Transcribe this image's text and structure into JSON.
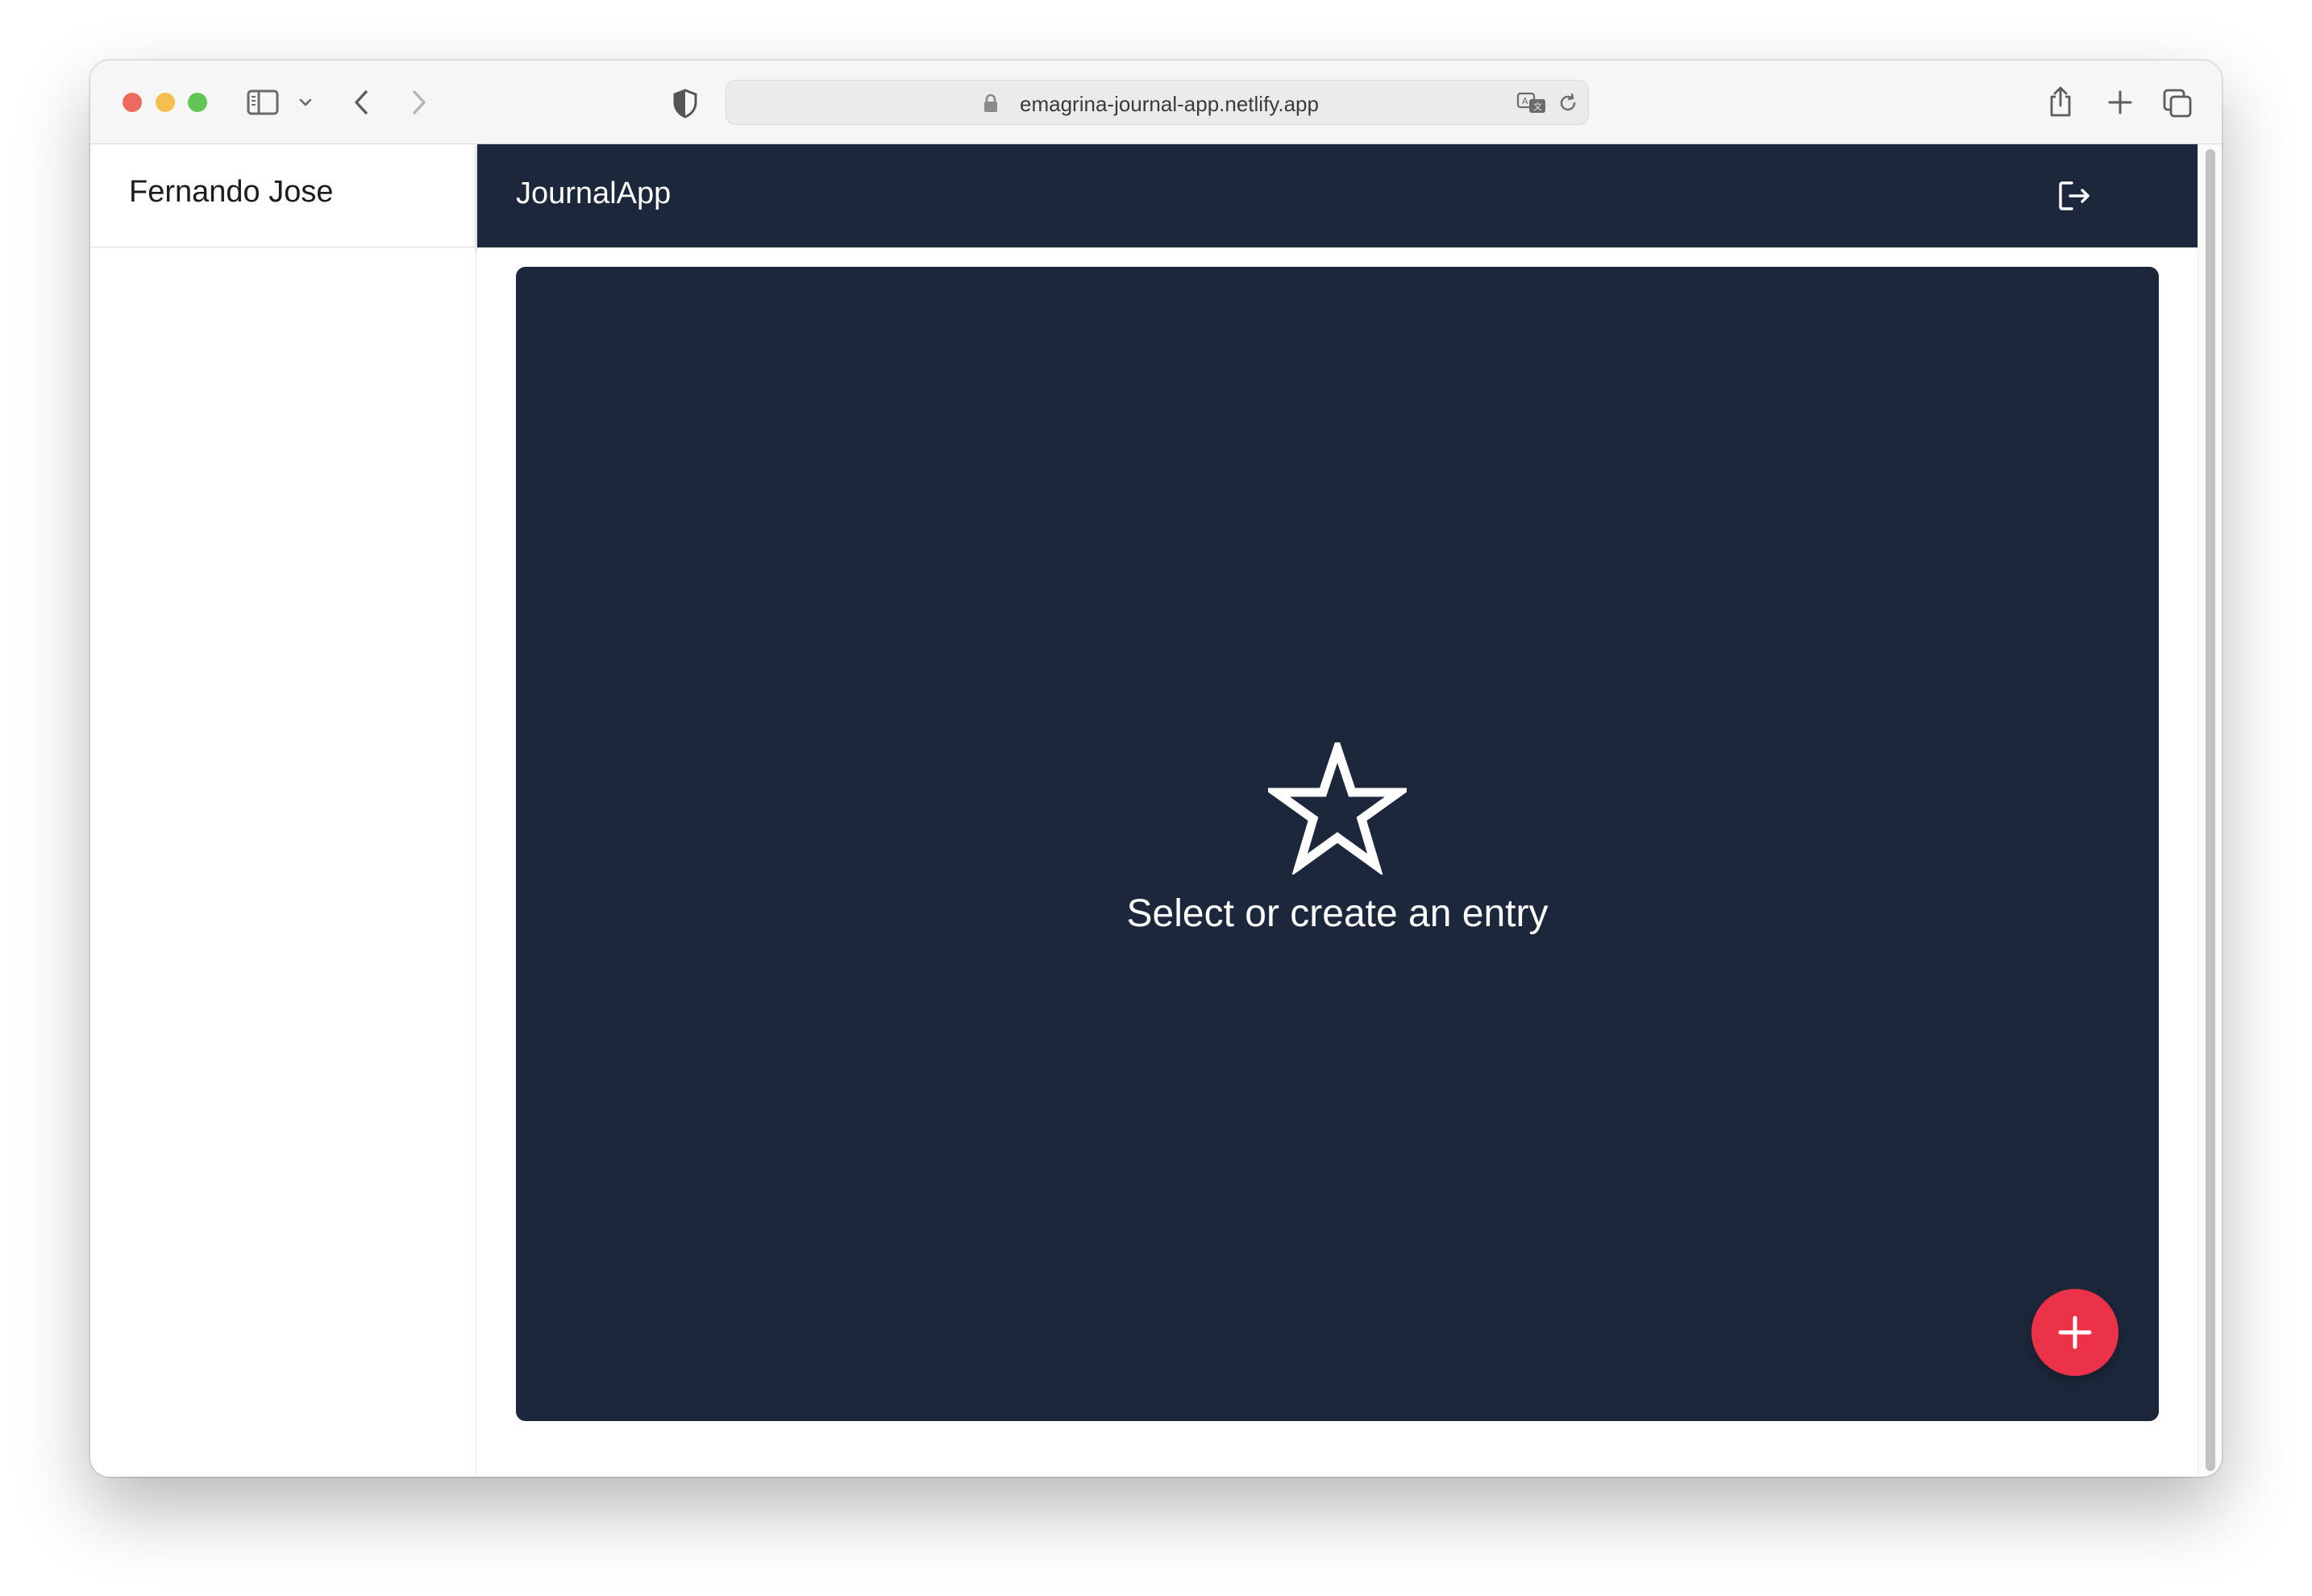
{
  "browser": {
    "url": "emagrina-journal-app.netlify.app",
    "colors": {
      "close": "#ed6a5e",
      "minimize": "#f5bf4f",
      "zoom": "#61c554"
    }
  },
  "sidebar": {
    "username": "Fernando Jose"
  },
  "appbar": {
    "title": "JournalApp",
    "logout_icon": "logout-icon"
  },
  "main": {
    "empty_icon": "star-outline-icon",
    "empty_text": "Select or create an entry",
    "add_button_icon": "plus-icon"
  },
  "colors": {
    "primary": "#1c273b",
    "accent": "#ec3248"
  }
}
